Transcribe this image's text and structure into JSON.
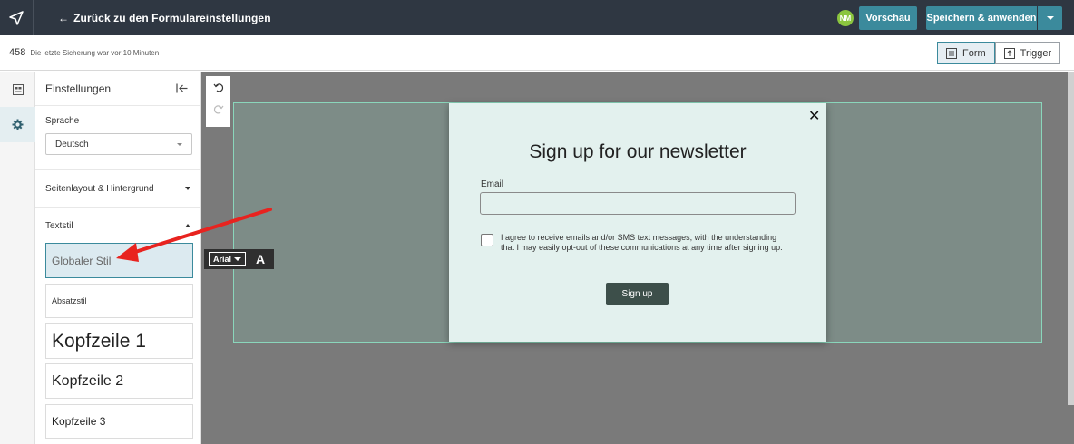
{
  "topbar": {
    "back_label": "Zurück zu den Formulareinstellungen",
    "back_arrow": "←",
    "avatar_initials": "NM",
    "preview_label": "Vorschau",
    "save_apply_label": "Speichern & anwenden"
  },
  "subbar": {
    "count": "458",
    "last_save": "Die letzte Sicherung war vor 10 Minuten",
    "view_form": "Form",
    "view_trigger": "Trigger"
  },
  "panel": {
    "title": "Einstellungen",
    "language_label": "Sprache",
    "language_value": "Deutsch",
    "sections": [
      {
        "label": "Seitenlayout & Hintergrund",
        "expanded": false
      },
      {
        "label": "Textstil",
        "expanded": true
      }
    ],
    "text_styles": [
      {
        "label": "Globaler Stil",
        "selected": true
      },
      {
        "label": "Absatzstil",
        "selected": false
      },
      {
        "label": "Kopfzeile 1",
        "selected": false
      },
      {
        "label": "Kopfzeile 2",
        "selected": false
      },
      {
        "label": "Kopfzeile 3",
        "selected": false
      }
    ]
  },
  "font_toolbar": {
    "font_family": "Arial",
    "size_icon": "A"
  },
  "popup": {
    "title": "Sign up for our newsletter",
    "email_label": "Email",
    "consent_text": "I agree to receive emails and/or SMS text messages, with the understanding that I may easily opt-out of these communications at any time after signing up.",
    "button_label": "Sign up",
    "close_glyph": "✕"
  },
  "colors": {
    "topbar": "#2f3742",
    "accent": "#3b8a9c",
    "avatar": "#8bc53f",
    "annotation_arrow": "#e8231f",
    "canvas": "#7a7a7a",
    "popup_bg": "#e3f1ee"
  }
}
